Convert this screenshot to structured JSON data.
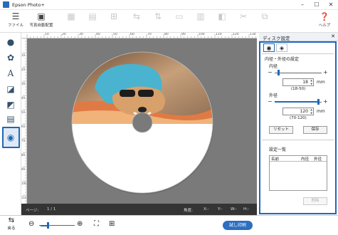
{
  "window": {
    "title": "Epson Photo+",
    "controls": [
      "–",
      "☐",
      "✕"
    ]
  },
  "toolbar": {
    "menu_label": "ファイル",
    "auto_layout_label": "写真自動配置",
    "help_label": "ヘルプ",
    "disabled_icon_count": 10
  },
  "side_panel": {
    "title": "ディスク設定",
    "close_symbol": "✕",
    "section_title": "内径・外径の設定",
    "inner": {
      "label": "内径",
      "value": "18",
      "unit": "mm",
      "range": "(18-50)",
      "level": 0.0
    },
    "outer": {
      "label": "外径",
      "value": "120",
      "unit": "mm",
      "range": "(70-120)",
      "level": 1.0
    },
    "reset_label": "リセット",
    "save_label": "保存",
    "list_title": "設定一覧",
    "list_columns": [
      "名前",
      "内径",
      "外径"
    ],
    "delete_label": "削除"
  },
  "status_bar": {
    "page_label": "ページ:",
    "page_value": "1 / 1",
    "angle_label": "角度:",
    "x_label": "X:-",
    "y_label": "Y:-",
    "w_label": "W:-",
    "h_label": "H:-"
  },
  "bottom_bar": {
    "back_label": "戻る",
    "print_label": "試し印刷"
  },
  "ruler": {
    "top_ticks": [
      "10",
      "20",
      "30",
      "40",
      "50",
      "60",
      "70",
      "80",
      "90",
      "100",
      "110",
      "120",
      "130"
    ],
    "left_ticks": [
      "10",
      "20",
      "30",
      "40",
      "50",
      "60",
      "70",
      "80",
      "90",
      "100",
      "110"
    ]
  },
  "colors": {
    "accent": "#1e68b8",
    "canvas_bg": "#7a7a7a",
    "status_bg": "#343434"
  }
}
